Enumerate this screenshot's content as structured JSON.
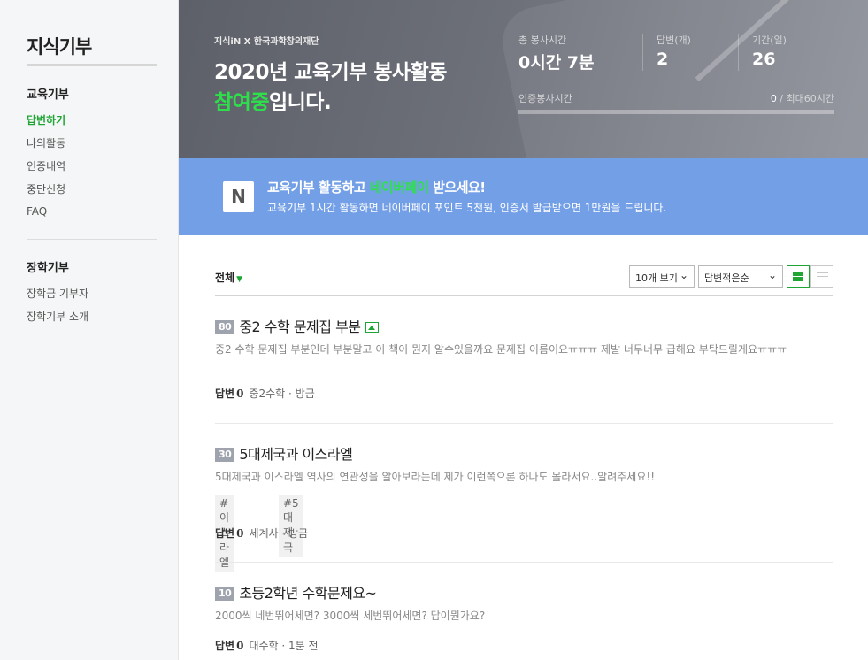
{
  "sidebar": {
    "title": "지식기부",
    "section1": {
      "title": "교육기부",
      "items": [
        "답변하기",
        "나의활동",
        "인증내역",
        "중단신청",
        "FAQ"
      ]
    },
    "section2": {
      "title": "장학기부",
      "items": [
        "장학금 기부자",
        "장학기부 소개"
      ]
    }
  },
  "hero": {
    "kicker": "지식iN X 한국과학창의재단",
    "headline_line1": "2020년 교육기부 봉사활동",
    "headline_highlight": "참여중",
    "headline_rest": "입니다.",
    "stats": [
      {
        "label": "총 봉사시간",
        "value": "0시간 7분"
      },
      {
        "label": "답변(개)",
        "value": "2"
      },
      {
        "label": "기간(일)",
        "value": "26"
      }
    ],
    "cert_label": "인증봉사시간",
    "cert_current": "0",
    "cert_max": " / 최대60시간",
    "cert_progress": 0
  },
  "banner": {
    "logo": "N",
    "title_pre": "교육기부 활동하고 ",
    "title_highlight": "네이버페이",
    "title_post": " 받으세요!",
    "subtitle": "교육기부 1시간 활동하면 네이버페이 포인트 5천원, 인증서 발급받으면 1만원을 드립니다."
  },
  "toolbar": {
    "filter_label": "전체",
    "page_size": "10개 보기",
    "sort": "답변적은순"
  },
  "questions": [
    {
      "points": "80",
      "title": "중2 수학 문제집 부분",
      "has_image": true,
      "body": "중2 수학 문제집 부분인데 부분말고 이 책이 뭔지 알수있을까요 문제집 이름이요ㅠㅠㅠ 제발 너무너무 급해요 부탁드릴게요ㅠㅠㅠ",
      "tags": [],
      "answer_label": "답변",
      "answer_count": "0",
      "meta": "중2수학 · 방금"
    },
    {
      "points": "30",
      "title": "5대제국과 이스라엘",
      "has_image": false,
      "body": "5대제국과 이스라엘 역사의 연관성을 알아보라는데 제가 이런쪽으론 하나도 몰라서요..알려주세요!!",
      "tags": [
        "#이스라엘",
        "#5대제국"
      ],
      "answer_label": "답변",
      "answer_count": "0",
      "meta": "세계사 · 방금"
    },
    {
      "points": "10",
      "title": "초등2학년 수학문제요~",
      "has_image": false,
      "body": "2000씩 네번뛰어세면? 3000씩 세번뛰어세면? 답이뭔가요?",
      "tags": [],
      "answer_label": "답변",
      "answer_count": "0",
      "meta": "대수학 · 1분 전"
    }
  ],
  "colors": {
    "accent_green": "#1ea534",
    "highlight_green": "#2de04b",
    "banner_blue": "#739fe6",
    "hero_gray": "#6d7079"
  }
}
